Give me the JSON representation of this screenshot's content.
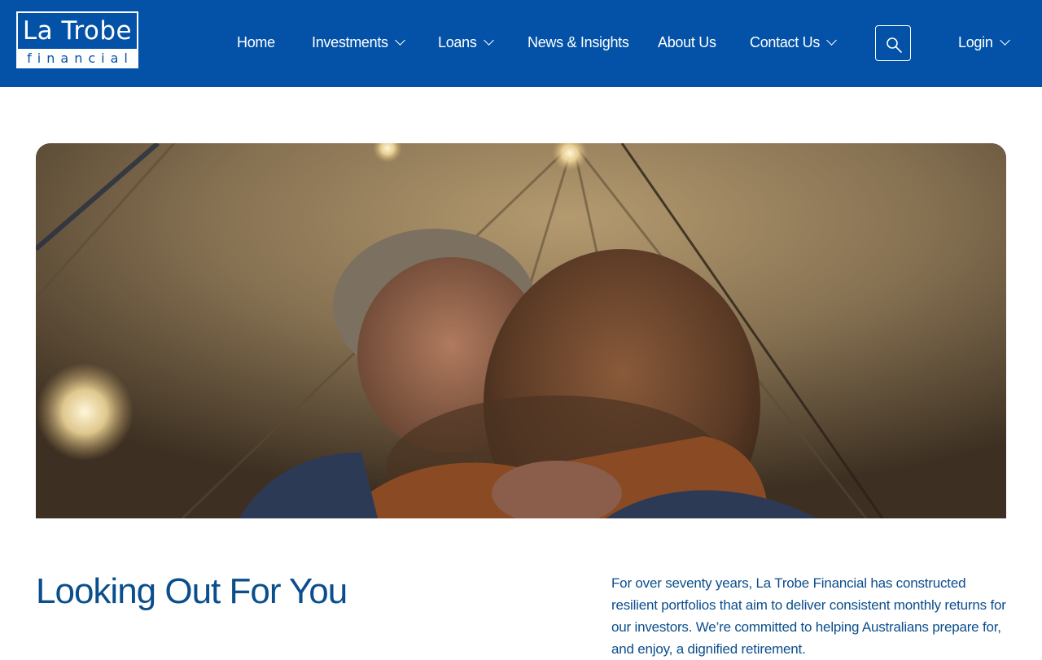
{
  "header": {
    "logo": {
      "line1": "La Trobe",
      "line2": "financial"
    },
    "nav": [
      {
        "label": "Home",
        "has_dropdown": false
      },
      {
        "label": "Investments",
        "has_dropdown": true
      },
      {
        "label": "Loans",
        "has_dropdown": true
      },
      {
        "label": "News & Insights",
        "has_dropdown": false
      },
      {
        "label": "About Us",
        "has_dropdown": false
      },
      {
        "label": "Contact Us",
        "has_dropdown": true
      }
    ],
    "search_icon": "search-icon",
    "login": {
      "label": "Login",
      "has_dropdown": true
    }
  },
  "hero": {
    "image_subject": "older man embracing a young girl inside a tent lit by string lights"
  },
  "main": {
    "title": "Looking Out For You",
    "intro": "For over seventy years, La Trobe Financial has constructed resilient portfolios that aim to deliver consistent monthly returns for our investors. We’re committed to helping Australians prepare for, and enjoy, a dignified retirement."
  },
  "colors": {
    "brand_blue": "#0352a8",
    "heading_blue": "#0b4e8c",
    "white": "#ffffff"
  }
}
